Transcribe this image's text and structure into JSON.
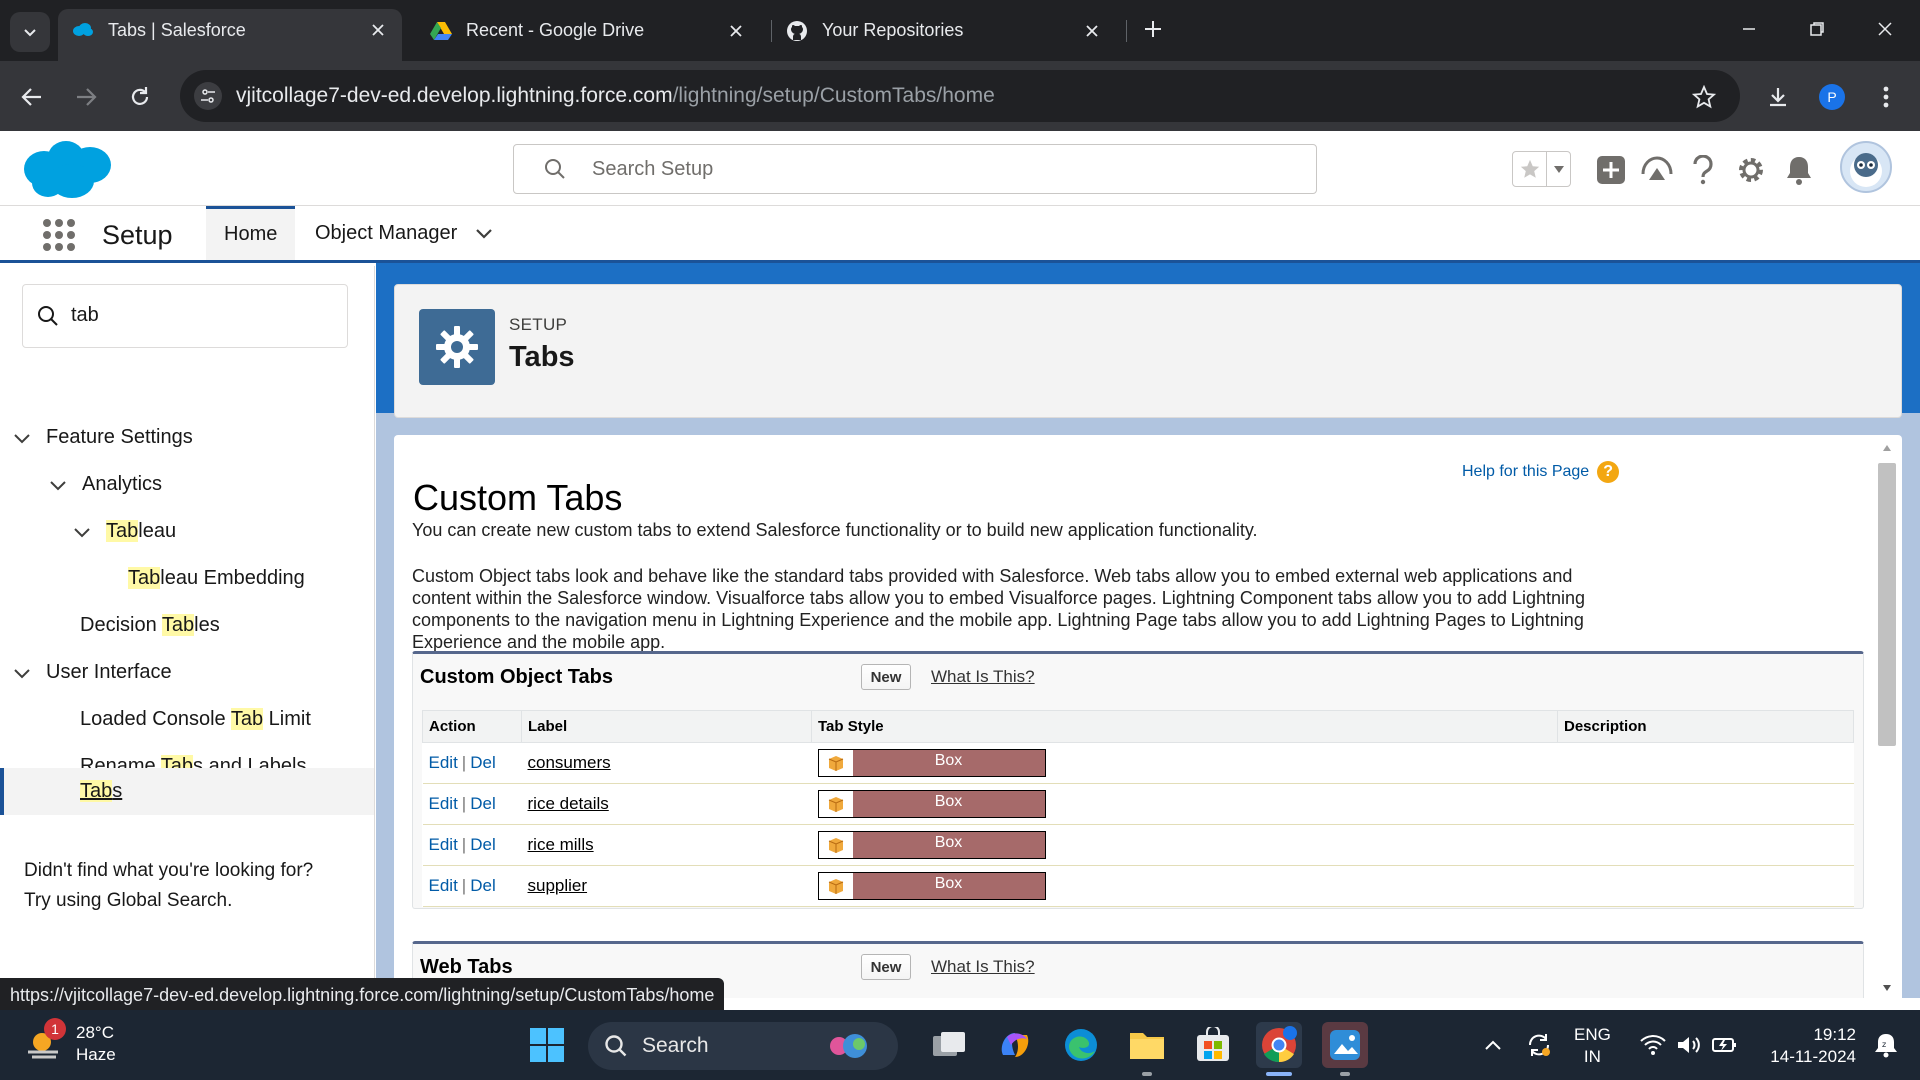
{
  "browser": {
    "tabs": [
      {
        "title": "Tabs | Salesforce",
        "icon": "salesforce-cloud-icon"
      },
      {
        "title": "Recent - Google Drive",
        "icon": "google-drive-icon"
      },
      {
        "title": "Your Repositories",
        "icon": "github-icon"
      }
    ],
    "url_host": "vjitcollage7-dev-ed.develop.lightning.force.com",
    "url_path": "/lightning/setup/CustomTabs/home",
    "profile_initial": "P"
  },
  "sf_header": {
    "search_placeholder": "Search Setup"
  },
  "sf_nav": {
    "app_name": "Setup",
    "tabs": [
      "Home",
      "Object Manager"
    ]
  },
  "sidebar": {
    "quick_find_value": "tab",
    "items": [
      {
        "pre": "",
        "mark": "",
        "post": "Feature Settings"
      },
      {
        "pre": "",
        "mark": "",
        "post": "Analytics"
      },
      {
        "pre": "",
        "mark": "Tab",
        "post": "leau"
      },
      {
        "pre": "",
        "mark": "Tab",
        "post": "leau Embedding"
      },
      {
        "pre": "Decision ",
        "mark": "Tab",
        "post": "les"
      },
      {
        "pre": "",
        "mark": "",
        "post": "User Interface"
      },
      {
        "pre": "Loaded Console ",
        "mark": "Tab",
        "post": " Limit"
      },
      {
        "pre": "Rename ",
        "mark": "Tab",
        "post": "s and Labels"
      },
      {
        "pre": "",
        "mark": "Tab",
        "post": "s"
      }
    ],
    "footer_line1": "Didn't find what you're looking for?",
    "footer_line2": "Try using Global Search."
  },
  "page_header": {
    "eyebrow": "SETUP",
    "title": "Tabs"
  },
  "content": {
    "title": "Custom Tabs",
    "help_link": "Help for this Page",
    "help_icon": "?",
    "intro": "You can create new custom tabs to extend Salesforce functionality or to build new application functionality.",
    "description": "Custom Object tabs look and behave like the standard tabs provided with Salesforce. Web tabs allow you to embed external web applications and content within the Salesforce window. Visualforce tabs allow you to embed Visualforce pages. Lightning Component tabs allow you to add Lightning components to the navigation menu in Lightning Experience and the mobile app. Lightning Page tabs allow you to add Lightning Pages to Lightning Experience and the mobile app."
  },
  "custom_object_tabs": {
    "title": "Custom Object Tabs",
    "new_label": "New",
    "what_label": "What Is This?",
    "columns": [
      "Action",
      "Label",
      "Tab Style",
      "Description"
    ],
    "action_edit": "Edit",
    "action_sep": "|",
    "action_del": "Del",
    "rows": [
      {
        "label": "consumers",
        "style": "Box",
        "description": ""
      },
      {
        "label": "rice details",
        "style": "Box",
        "description": ""
      },
      {
        "label": "rice mills",
        "style": "Box",
        "description": ""
      },
      {
        "label": "supplier",
        "style": "Box",
        "description": ""
      }
    ],
    "style_color": "#a66a6a"
  },
  "web_tabs": {
    "title": "Web Tabs",
    "new_label": "New",
    "what_label": "What Is This?"
  },
  "status_url": "https://vjitcollage7-dev-ed.develop.lightning.force.com/lightning/setup/CustomTabs/home",
  "taskbar": {
    "weather_temp": "28°C",
    "weather_desc": "Haze",
    "weather_badge": "1",
    "search_label": "Search",
    "lang_line1": "ENG",
    "lang_line2": "IN",
    "time": "19:12",
    "date": "14-11-2024"
  },
  "colors": {
    "salesforce_blue": "#1b5297",
    "brand_cloud": "#00a1e0",
    "setup_icon_bg": "#3e6b95"
  }
}
